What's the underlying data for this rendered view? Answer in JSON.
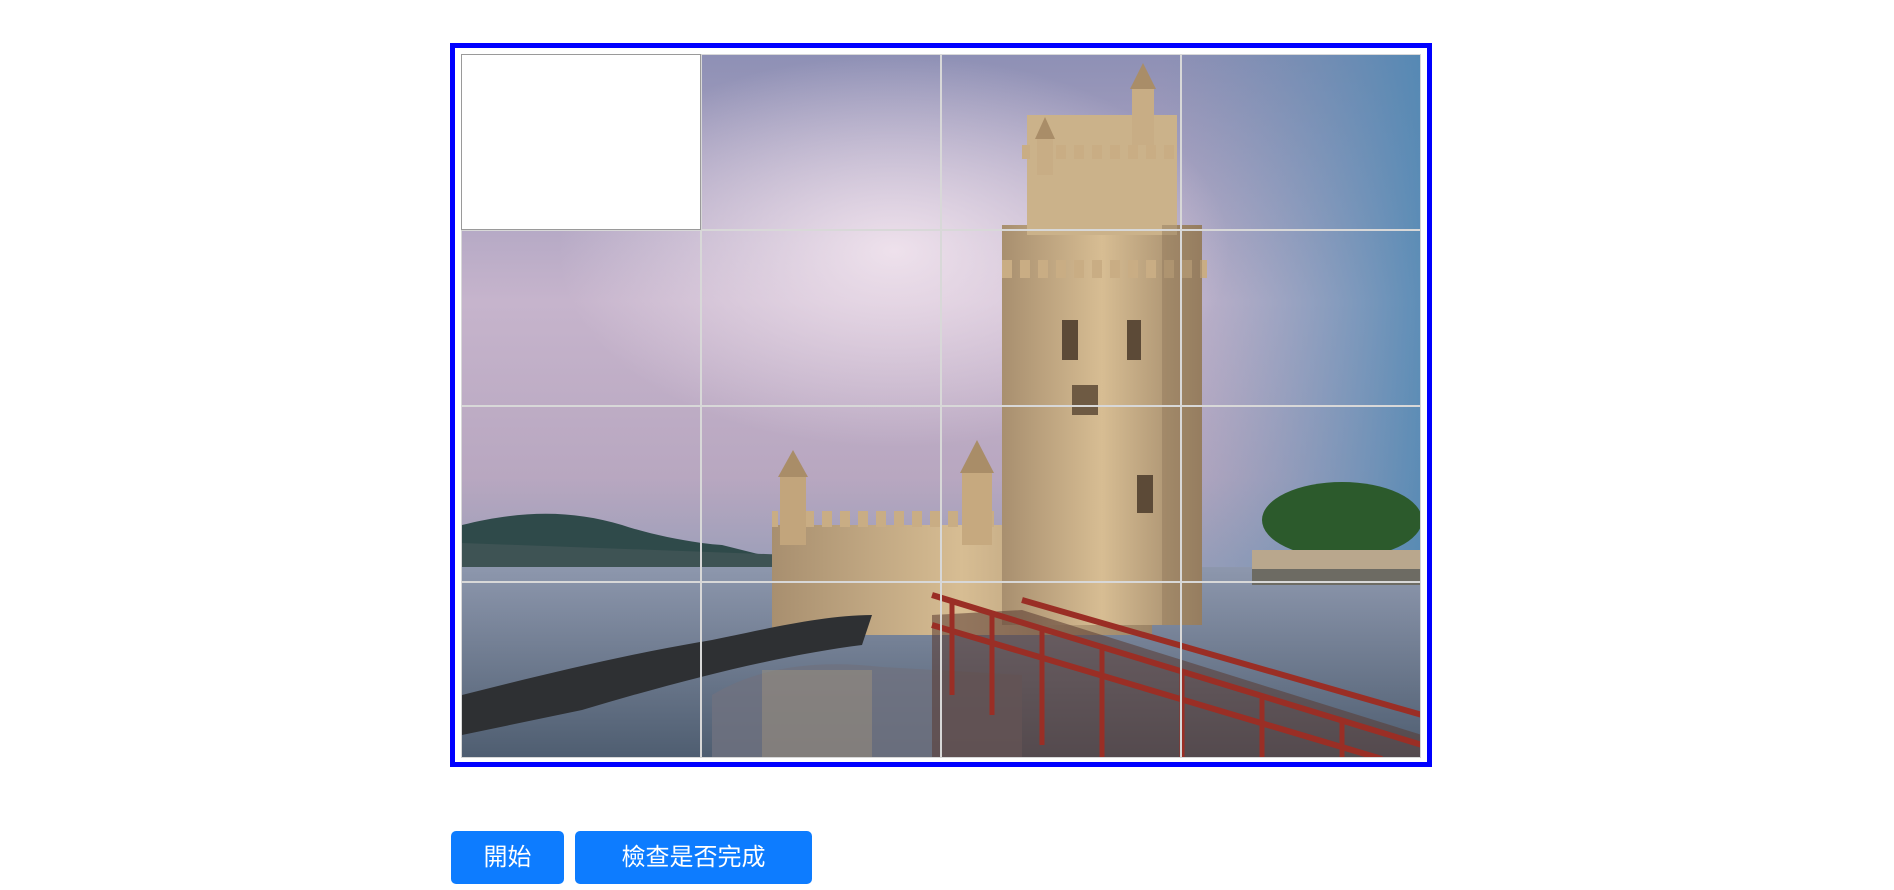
{
  "puzzle": {
    "rows": 4,
    "cols": 4,
    "empty_tile": 0,
    "tiles": [
      0,
      1,
      2,
      3,
      4,
      5,
      6,
      7,
      8,
      9,
      10,
      11,
      12,
      13,
      14,
      15
    ]
  },
  "controls": {
    "start_label": "開始",
    "check_label": "檢查是否完成"
  },
  "colors": {
    "board_border": "#0000ff",
    "button_bg": "#0d7cff",
    "button_text": "#ffffff"
  }
}
